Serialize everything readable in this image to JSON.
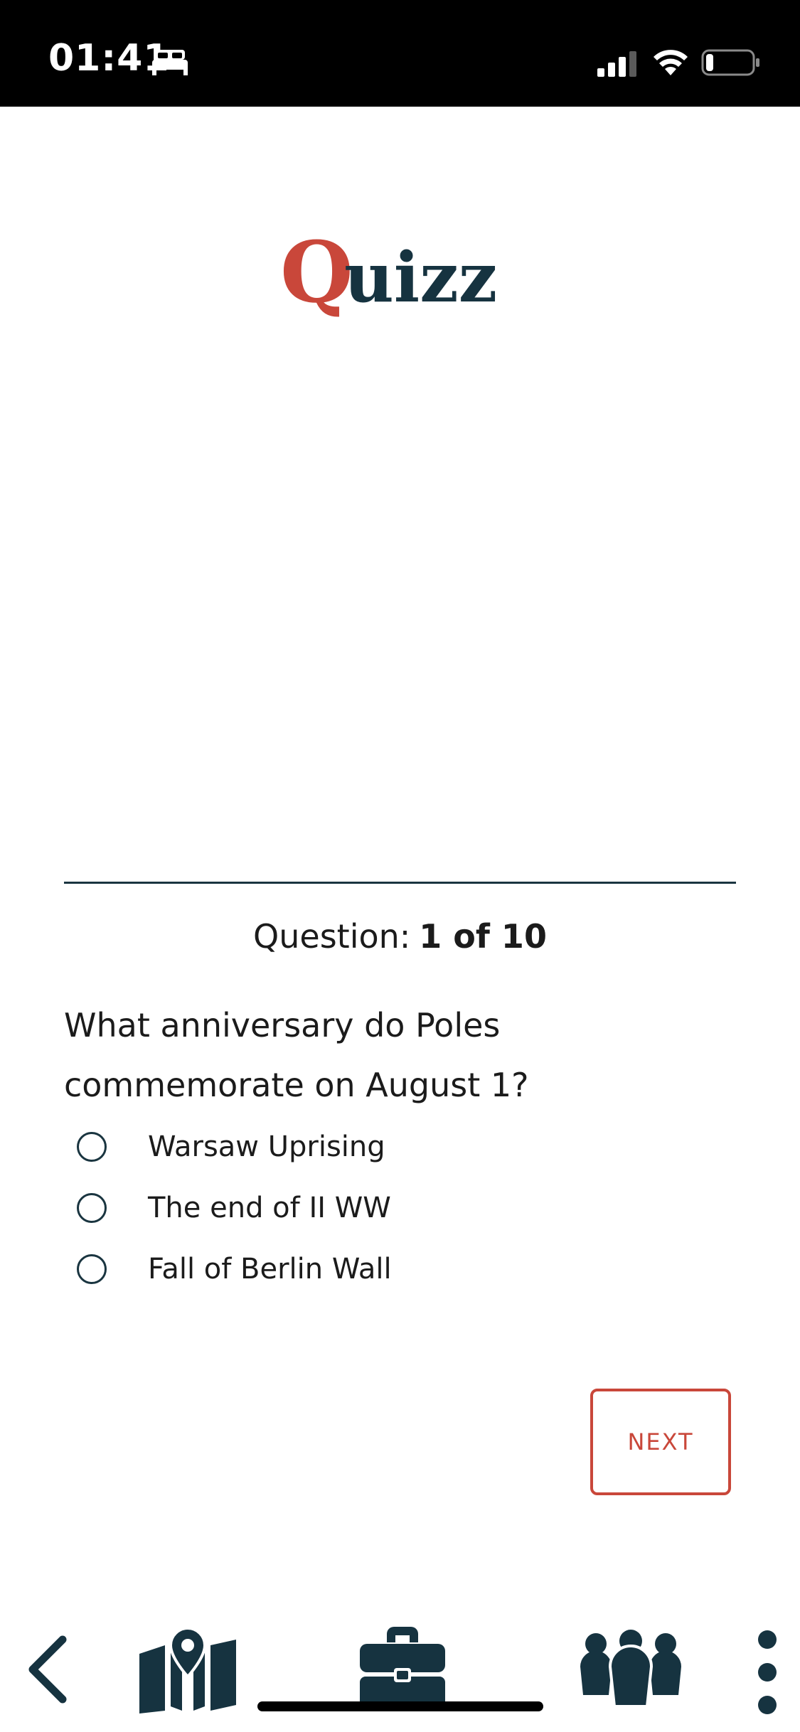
{
  "status_bar": {
    "time": "01:41",
    "icons": [
      "bed-icon",
      "cellular-signal-icon",
      "wifi-icon",
      "battery-icon"
    ]
  },
  "logo": {
    "text_q": "Q",
    "text_rest": "uizz",
    "colors": {
      "q": "#c9473a",
      "rest": "#163340"
    }
  },
  "quiz": {
    "counter_label": "Question:",
    "counter_value": "1 of 10",
    "question": "What anniversary do Poles commemorate on August 1?",
    "options": [
      {
        "label": "Warsaw Uprising"
      },
      {
        "label": "The end of II WW"
      },
      {
        "label": "Fall of Berlin Wall"
      }
    ],
    "next_label": "NEXT"
  },
  "bottom_nav": {
    "items": [
      "back-icon",
      "map-icon",
      "briefcase-icon",
      "community-icon",
      "more-icon"
    ]
  },
  "colors": {
    "accent": "#c9473a",
    "dark": "#163340",
    "text": "#1b1b1b",
    "status_bar_bg": "#000000"
  }
}
